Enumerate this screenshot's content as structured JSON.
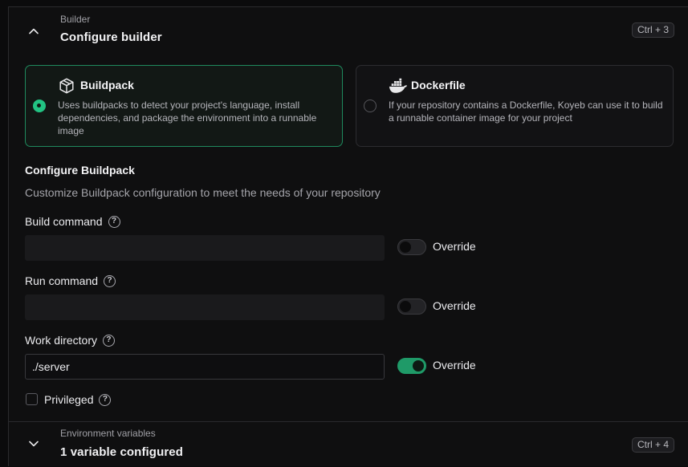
{
  "builder_section": {
    "kicker": "Builder",
    "title": "Configure builder",
    "shortcut": "Ctrl + 3",
    "expanded": true
  },
  "builder_options": [
    {
      "id": "buildpack",
      "title": "Buildpack",
      "icon": "package-icon",
      "description": "Uses buildpacks to detect your project's language, install dependencies, and package the environment into a runnable image",
      "selected": true
    },
    {
      "id": "dockerfile",
      "title": "Dockerfile",
      "icon": "docker-icon",
      "description": "If your repository contains a Dockerfile, Koyeb can use it to build a runnable container image for your project",
      "selected": false
    }
  ],
  "buildpack_config": {
    "heading": "Configure Buildpack",
    "description": "Customize Buildpack configuration to meet the needs of your repository",
    "fields": [
      {
        "label": "Build command",
        "value": "",
        "override_label": "Override",
        "override": false
      },
      {
        "label": "Run command",
        "value": "",
        "override_label": "Override",
        "override": false
      },
      {
        "label": "Work directory",
        "value": "./server",
        "override_label": "Override",
        "override": true
      }
    ],
    "privileged_label": "Privileged",
    "privileged": false
  },
  "env_section": {
    "kicker": "Environment variables",
    "title": "1 variable configured",
    "shortcut": "Ctrl + 4",
    "expanded": false
  },
  "colors": {
    "accent": "#22c383",
    "toggle_on": "#1f9a68",
    "background": "#0f0f10"
  }
}
